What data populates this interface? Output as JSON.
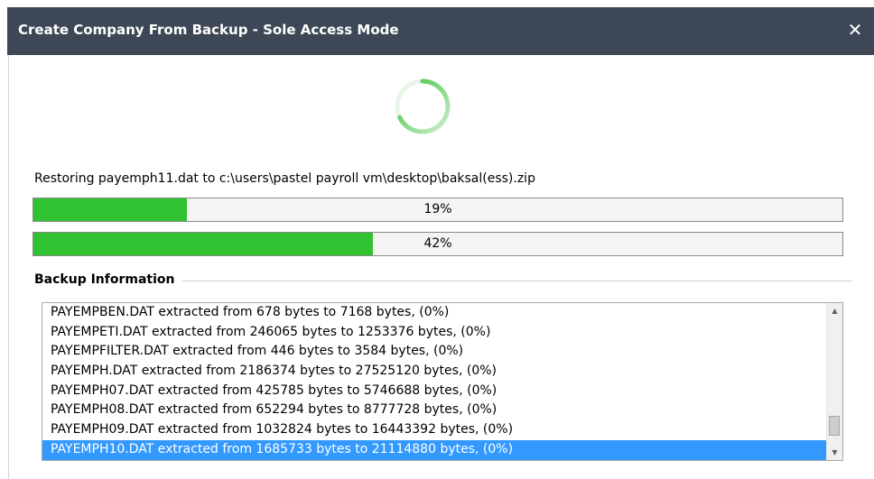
{
  "window": {
    "title": "Create Company From Backup - Sole Access Mode",
    "close_glyph": "✕"
  },
  "status": {
    "text": "Restoring  payemph11.dat to c:\\users\\pastel payroll vm\\desktop\\baksal(ess).zip"
  },
  "progress": [
    {
      "label": "19%",
      "fraction": 0.19
    },
    {
      "label": "42%",
      "fraction": 0.42
    }
  ],
  "backup_info": {
    "label": "Backup Information",
    "items": [
      "PAYEMPBEN.DAT extracted from 678 bytes to 7168 bytes, (0%)",
      "PAYEMPETI.DAT extracted from 246065 bytes to 1253376 bytes, (0%)",
      "PAYEMPFILTER.DAT extracted from 446 bytes to 3584 bytes, (0%)",
      "PAYEMPH.DAT extracted from 2186374 bytes to 27525120 bytes, (0%)",
      "PAYEMPH07.DAT extracted from 425785 bytes to 5746688 bytes, (0%)",
      "PAYEMPH08.DAT extracted from 652294 bytes to 8777728 bytes, (0%)",
      "PAYEMPH09.DAT extracted from 1032824 bytes to 16443392 bytes, (0%)",
      "PAYEMPH10.DAT extracted from 1685733 bytes to 21114880 bytes, (0%)"
    ],
    "selected_index": 7
  },
  "colors": {
    "titlebar": "#3d4756",
    "progress_fill": "#31c231",
    "selection": "#3399ff",
    "spinner": "#3cc43c"
  },
  "icons": {
    "close": "close-icon",
    "spinner": "loading-spinner-icon",
    "scroll_up": "scroll-up-arrow-icon",
    "scroll_down": "scroll-down-arrow-icon"
  }
}
